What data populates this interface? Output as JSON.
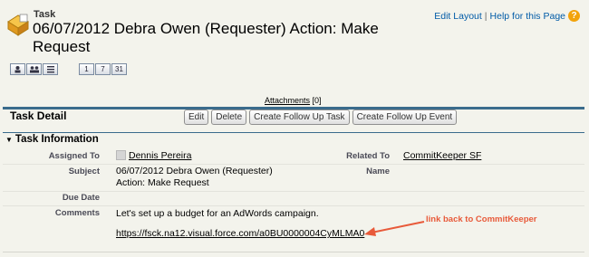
{
  "header": {
    "object_type": "Task",
    "title": "06/07/2012 Debra Owen (Requester) Action: Make Request",
    "edit_layout": "Edit Layout",
    "separator": "|",
    "help_link": "Help for this Page",
    "help_symbol": "?"
  },
  "view_buttons": [
    {
      "icon": "single-user-icon",
      "label": ""
    },
    {
      "icon": "multi-user-icon",
      "label": ""
    },
    {
      "icon": "list-icon",
      "label": ""
    },
    {
      "icon": "day-view-icon",
      "label": "1"
    },
    {
      "icon": "week-view-icon",
      "label": "7"
    },
    {
      "icon": "month-view-icon",
      "label": "31"
    }
  ],
  "attachments": {
    "label": "Attachments",
    "count": "[0]"
  },
  "detail": {
    "title": "Task Detail",
    "buttons": [
      "Edit",
      "Delete",
      "Create Follow Up Task",
      "Create Follow Up Event"
    ]
  },
  "section": {
    "title": "Task Information",
    "toggle_icon": "triangle-down-icon"
  },
  "fields": {
    "assigned_to": {
      "label": "Assigned To",
      "value": "Dennis Pereira"
    },
    "related_to": {
      "label": "Related To",
      "value": "CommitKeeper SF"
    },
    "subject": {
      "label": "Subject",
      "line1": "06/07/2012 Debra Owen (Requester)",
      "line2": "Action: Make Request"
    },
    "name": {
      "label": "Name",
      "value": ""
    },
    "due_date": {
      "label": "Due Date",
      "value": ""
    },
    "comments": {
      "label": "Comments",
      "text": "Let's set up a budget for an AdWords campaign.",
      "url": "https://fsck.na12.visual.force.com/a0BU0000004CyMLMA0"
    }
  },
  "annotation": {
    "text": "link back to CommitKeeper",
    "color": "#e85a3a"
  },
  "colors": {
    "section_accent": "#3a6b8c",
    "link_blue": "#015ba7",
    "background": "#f3f3ec"
  }
}
